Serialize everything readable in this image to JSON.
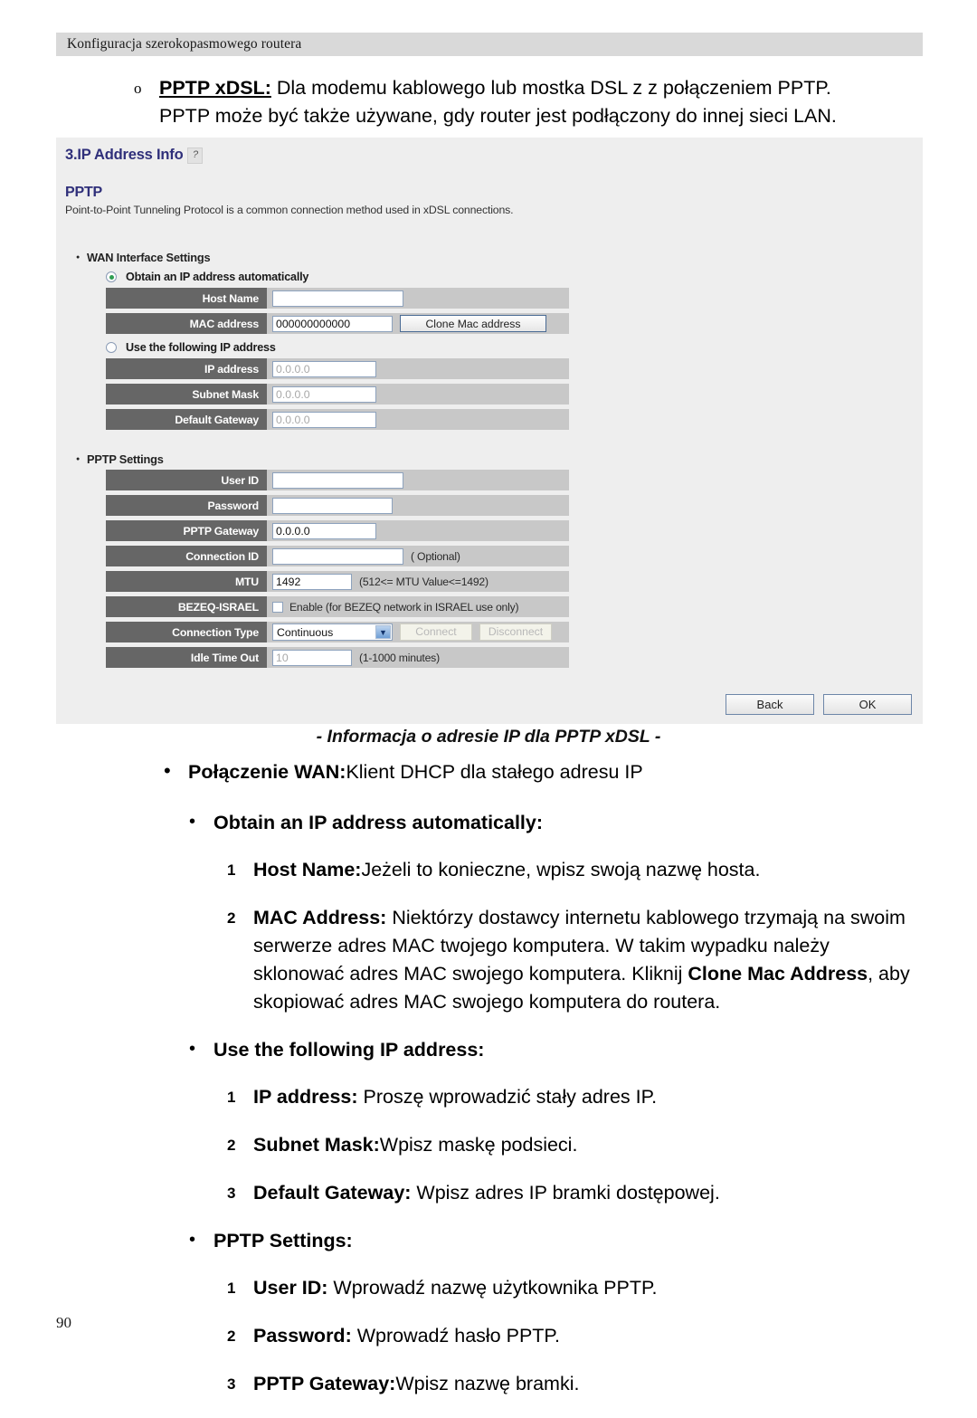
{
  "running_header": "Konfiguracja szerokopasmowego routera",
  "intro": {
    "marker": "o",
    "bold_lead": "PPTP xDSL:",
    "rest_line1": " Dla modemu kablowego lub mostka DSL z z połączeniem PPTP.",
    "line2": "PPTP może być także używane, gdy router jest podłączony do innej sieci LAN."
  },
  "router_ui": {
    "panel_title": "3.IP Address Info",
    "help_icon_glyph": "?",
    "pptp_heading": "PPTP",
    "pptp_description": "Point-to-Point Tunneling Protocol is a common connection method used in xDSL connections.",
    "wan_section_label": "WAN Interface Settings",
    "radio_auto": "Obtain an IP address automatically",
    "radio_manual": "Use the following IP address",
    "pptp_section_label": "PPTP Settings",
    "fields": {
      "host_name": {
        "label": "Host Name",
        "value": ""
      },
      "mac_address": {
        "label": "MAC address",
        "value": "000000000000",
        "button": "Clone Mac address"
      },
      "ip_address": {
        "label": "IP address",
        "value": "0.0.0.0"
      },
      "subnet_mask": {
        "label": "Subnet Mask",
        "value": "0.0.0.0"
      },
      "default_gateway": {
        "label": "Default Gateway",
        "value": "0.0.0.0"
      },
      "user_id": {
        "label": "User ID",
        "value": ""
      },
      "password": {
        "label": "Password",
        "value": ""
      },
      "pptp_gateway": {
        "label": "PPTP Gateway",
        "value": "0.0.0.0"
      },
      "connection_id": {
        "label": "Connection ID",
        "value": "",
        "hint": "( Optional)"
      },
      "mtu": {
        "label": "MTU",
        "value": "1492",
        "hint": "(512<= MTU Value<=1492)"
      },
      "bezeq": {
        "label": "BEZEQ-ISRAEL",
        "checkbox_label": "Enable (for BEZEQ network in ISRAEL use only)",
        "checked": false
      },
      "connection_type": {
        "label": "Connection Type",
        "value": "Continuous",
        "connect": "Connect",
        "disconnect": "Disconnect"
      },
      "idle_time_out": {
        "label": "Idle Time Out",
        "value": "10",
        "hint": "(1-1000 minutes)"
      }
    },
    "back_button": "Back",
    "ok_button": "OK",
    "colors": {
      "panel_bg": "#eeeeee",
      "label_cell": "#666666",
      "row_bg": "#c8c8c8",
      "heading_blue": "#2f2f7a",
      "radio_dot_green": "#2f9e52"
    }
  },
  "caption": "- Informacja o adresie IP dla PPTP xDSL -",
  "body": {
    "wan_item": {
      "bullet": "•",
      "bold": "Połączenie WAN:",
      "rest": "Klient DHCP dla stałego adresu IP"
    },
    "group_auto": {
      "bullet": "•",
      "title": "Obtain an IP address automatically:",
      "items": [
        {
          "num": "1",
          "bold": "Host Name:",
          "rest": "Jeżeli to konieczne, wpisz swoją nazwę hosta."
        },
        {
          "num": "2",
          "bold": "MAC Address:",
          "rest": " Niektórzy dostawcy internetu kablowego trzymają na swoim serwerze adres MAC twojego komputera. W takim wypadku należy sklonować adres MAC swojego komputera. Kliknij ",
          "bold2": "Clone Mac Address",
          "rest2": ", aby skopiować adres MAC swojego komputera do routera."
        }
      ]
    },
    "group_manual": {
      "bullet": "•",
      "title": "Use the following IP address:",
      "items": [
        {
          "num": "1",
          "bold": "IP address:",
          "rest": " Proszę wprowadzić stały adres IP."
        },
        {
          "num": "2",
          "bold": "Subnet Mask:",
          "rest": "Wpisz maskę podsieci."
        },
        {
          "num": "3",
          "bold": "Default Gateway:",
          "rest": " Wpisz adres IP bramki dostępowej."
        }
      ]
    },
    "group_pptp": {
      "bullet": "•",
      "title": "PPTP Settings:",
      "items": [
        {
          "num": "1",
          "bold": "User ID:",
          "rest": " Wprowadź nazwę użytkownika PPTP."
        },
        {
          "num": "2",
          "bold": "Password:",
          "rest": " Wprowadź hasło PPTP."
        },
        {
          "num": "3",
          "bold": "PPTP Gateway:",
          "rest": "Wpisz nazwę bramki."
        }
      ]
    }
  },
  "page_number": "90"
}
